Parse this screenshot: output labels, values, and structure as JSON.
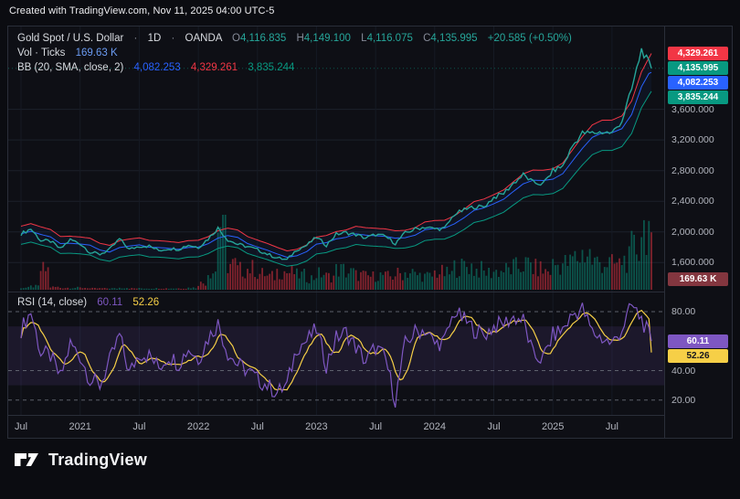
{
  "attribution": "Created with TradingView.com, Nov 11, 2025 04:00 UTC-5",
  "header": {
    "row1": {
      "symbol": "Gold Spot / U.S. Dollar",
      "sep1": "·",
      "interval": "1D",
      "sep2": "·",
      "exchange": "OANDA",
      "o_label": "O",
      "o": "4,116.835",
      "h_label": "H",
      "h": "4,149.100",
      "l_label": "L",
      "l": "4,116.075",
      "c_label": "C",
      "c": "4,135.995",
      "change": "+20.585 (+0.50%)"
    },
    "row2": {
      "label": "Vol · Ticks",
      "value": "169.63 K"
    },
    "row3": {
      "label": "BB (20, SMA, close, 2)",
      "basis": "4,082.253",
      "upper": "4,329.261",
      "lower": "3,835.244"
    }
  },
  "rsi_legend": {
    "label": "RSI (14, close)",
    "value": "60.11",
    "ma_value": "52.26"
  },
  "price_scale": {
    "ticks": [
      {
        "label": "3,600.000",
        "value": 3600
      },
      {
        "label": "3,200.000",
        "value": 3200
      },
      {
        "label": "2,800.000",
        "value": 2800
      },
      {
        "label": "2,400.000",
        "value": 2400
      },
      {
        "label": "2,000.000",
        "value": 2000
      },
      {
        "label": "1,600.000",
        "value": 1600
      }
    ],
    "badges": [
      {
        "label": "4,329.261",
        "value": 4329.261,
        "bg": "#f23645",
        "fg": "#ffffff"
      },
      {
        "label": "4,135.995",
        "value": 4135.995,
        "bg": "#089981",
        "fg": "#ffffff"
      },
      {
        "label": "4,082.253",
        "value": 4082.253,
        "bg": "#2962ff",
        "fg": "#ffffff"
      },
      {
        "label": "3,835.244",
        "value": 3835.244,
        "bg": "#089981",
        "fg": "#ffffff"
      }
    ],
    "volume_badge": {
      "label": "169.63 K",
      "bg": "#83363f",
      "fg": "#ffffff"
    }
  },
  "rsi_scale": {
    "ticks": [
      {
        "label": "80.00",
        "value": 80
      },
      {
        "label": "40.00",
        "value": 40
      },
      {
        "label": "20.00",
        "value": 20
      }
    ],
    "badges": [
      {
        "label": "60.11",
        "value": 60.11,
        "bg": "#7e57c2",
        "fg": "#ffffff"
      },
      {
        "label": "52.26",
        "value": 52.26,
        "bg": "#f6cf47",
        "fg": "#15171e"
      }
    ]
  },
  "time_axis": {
    "ticks": [
      {
        "label": "Jul",
        "i": 0
      },
      {
        "label": "2021",
        "i": 6
      },
      {
        "label": "Jul",
        "i": 12
      },
      {
        "label": "2022",
        "i": 18
      },
      {
        "label": "Jul",
        "i": 24
      },
      {
        "label": "2023",
        "i": 30
      },
      {
        "label": "Jul",
        "i": 36
      },
      {
        "label": "2024",
        "i": 42
      },
      {
        "label": "Jul",
        "i": 48
      },
      {
        "label": "2025",
        "i": 54
      },
      {
        "label": "Jul",
        "i": 60
      }
    ]
  },
  "footer": {
    "brand": "TradingView"
  },
  "colors": {
    "up": "#26a69a",
    "down": "#f23645",
    "blue": "#2962ff",
    "teal": "#089981",
    "rsi": "#7e57c2",
    "rsiMa": "#f6cf47",
    "volval": "#6b9bf2",
    "grid": "#1c202b",
    "vgrid": "#161a24",
    "rsi_band_fill": "rgba(126,87,194,0.13)",
    "rsi_dash": "#6a6e79"
  },
  "chart_data": {
    "type": "line",
    "title": "Gold Spot / U.S. Dollar, 1D, OANDA",
    "x_unit": "month",
    "x_start": "2020-07",
    "x_end": "2025-11",
    "price_axis": {
      "min": 1221,
      "max": 4681,
      "ticks": [
        3600,
        3200,
        2800,
        2400,
        2000,
        1600
      ]
    },
    "rsi_axis": {
      "ticks": [
        80,
        40,
        20
      ],
      "band": [
        30,
        70
      ]
    },
    "close": [
      1975,
      2040,
      1886,
      1878,
      1777,
      1898,
      1848,
      1734,
      1708,
      1769,
      1907,
      1770,
      1814,
      1814,
      1757,
      1783,
      1775,
      1829,
      1797,
      1909,
      2050,
      1897,
      1837,
      1807,
      1766,
      1711,
      1661,
      1634,
      1769,
      1824,
      1928,
      1827,
      1969,
      1990,
      1963,
      1919,
      1965,
      1940,
      1849,
      1984,
      2036,
      2063,
      2040,
      2044,
      2230,
      2286,
      2327,
      2327,
      2448,
      2503,
      2635,
      2744,
      2643,
      2625,
      2798,
      2858,
      3124,
      3289,
      3289,
      3303,
      3290,
      3448,
      3859,
      4380,
      4135.995
    ],
    "volume_rel": [
      3,
      5,
      30,
      4,
      3,
      3,
      3,
      2,
      2,
      2,
      3,
      2,
      2,
      2,
      2,
      2,
      2,
      3,
      10,
      28,
      100,
      38,
      30,
      32,
      24,
      20,
      28,
      26,
      22,
      18,
      24,
      20,
      30,
      26,
      22,
      20,
      22,
      20,
      24,
      26,
      22,
      20,
      26,
      24,
      34,
      36,
      30,
      26,
      28,
      30,
      34,
      38,
      32,
      28,
      38,
      40,
      48,
      55,
      42,
      40,
      38,
      45,
      62,
      95,
      60
    ],
    "rsi": [
      68,
      80,
      52,
      50,
      35,
      58,
      50,
      34,
      30,
      46,
      64,
      38,
      52,
      50,
      42,
      50,
      45,
      55,
      48,
      62,
      72,
      52,
      44,
      40,
      34,
      30,
      25,
      30,
      56,
      60,
      68,
      44,
      62,
      66,
      56,
      46,
      56,
      48,
      20,
      58,
      66,
      68,
      58,
      60,
      80,
      74,
      68,
      64,
      70,
      72,
      76,
      74,
      50,
      48,
      64,
      68,
      78,
      82,
      66,
      62,
      58,
      68,
      84,
      75,
      60.11
    ],
    "bb": {
      "length": 20,
      "stddev": 2,
      "upper_mult": 1.05,
      "lower_mult": 0.93,
      "last_upper": 4329.261,
      "last_basis": 4082.253,
      "last_lower": 3835.244
    },
    "last": {
      "close": 4135.995,
      "rsi": 60.11,
      "rsi_ma": 52.26,
      "volume": "169.63 K"
    }
  }
}
